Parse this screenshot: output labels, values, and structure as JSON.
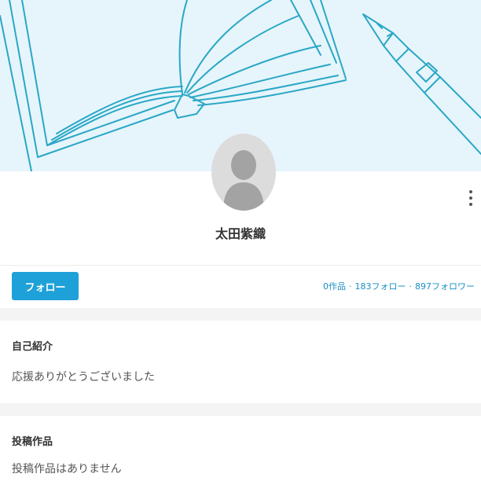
{
  "profile": {
    "name": "太田紫織"
  },
  "actions": {
    "follow_label": "フォロー"
  },
  "stats": {
    "works": "0作品",
    "following": "183フォロー",
    "followers": "897フォロワー",
    "separator": "·"
  },
  "bio": {
    "title": "自己紹介",
    "text": "応援ありがとうございました"
  },
  "posts": {
    "title": "投稿作品",
    "empty_text": "投稿作品はありません"
  },
  "colors": {
    "accent": "#1da1d8",
    "cover_bg": "#e6f5fb",
    "cover_line": "#2aa7c6"
  },
  "icons": {
    "menu": "more-vertical-icon",
    "avatar": "default-user-icon"
  }
}
